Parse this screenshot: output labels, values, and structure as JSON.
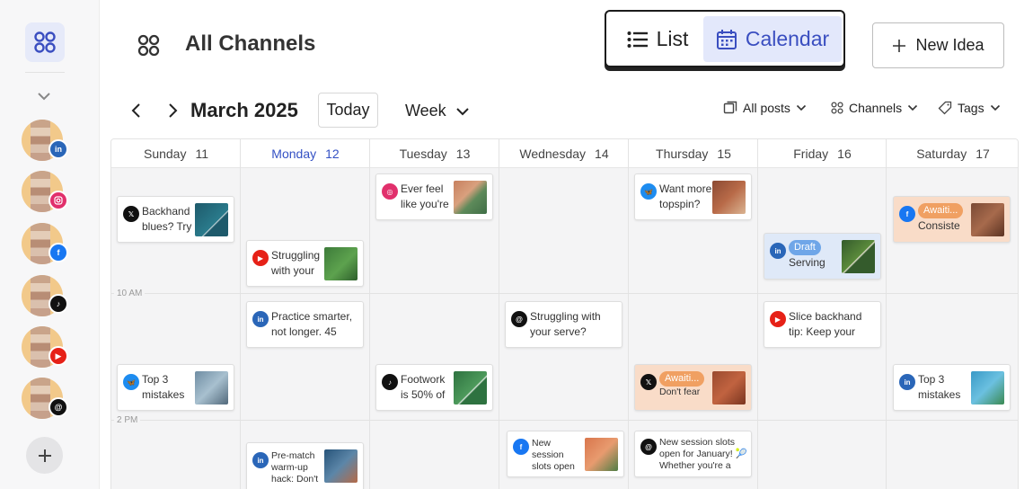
{
  "header": {
    "title": "All Channels"
  },
  "view_toggle": {
    "list": "List",
    "calendar": "Calendar"
  },
  "new_idea": "New Idea",
  "toolbar": {
    "month": "March 2025",
    "today": "Today",
    "range": "Week",
    "all_posts": "All posts",
    "channels": "Channels",
    "tags": "Tags"
  },
  "sidebar": {
    "channels": [
      "linkedin",
      "instagram",
      "facebook",
      "tiktok",
      "youtube",
      "threads"
    ]
  },
  "days": [
    {
      "name": "Sunday",
      "num": "11"
    },
    {
      "name": "Monday",
      "num": "12"
    },
    {
      "name": "Tuesday",
      "num": "13"
    },
    {
      "name": "Wednesday",
      "num": "14"
    },
    {
      "name": "Thursday",
      "num": "15"
    },
    {
      "name": "Friday",
      "num": "16"
    },
    {
      "name": "Saturday",
      "num": "17"
    }
  ],
  "times": {
    "t1": "10 AM",
    "t2": "2 PM"
  },
  "posts": {
    "p1": {
      "text": "Backhand blues? Try",
      "network": "x"
    },
    "p2": {
      "text": "Struggling with your",
      "network": "youtube"
    },
    "p3": {
      "text": "Ever feel like you're",
      "network": "instagram"
    },
    "p4": {
      "text": "Want more topspin?",
      "network": "bluesky"
    },
    "p5": {
      "status": "Awaiti...",
      "text": "Consiste",
      "network": "facebook"
    },
    "p6": {
      "status": "Draft",
      "text": "Serving",
      "network": "linkedin"
    },
    "p7": {
      "text": "Practice smarter, not longer. 45",
      "network": "linkedin"
    },
    "p8": {
      "text": "Struggling with your serve?",
      "network": "threads"
    },
    "p9": {
      "text": "Slice backhand tip: Keep your",
      "network": "youtube"
    },
    "p10": {
      "text": "Top 3 mistakes",
      "network": "bluesky"
    },
    "p11": {
      "text": "Footwork is 50% of",
      "network": "tiktok"
    },
    "p12": {
      "status": "Awaiti...",
      "text": "Don't fear",
      "network": "x"
    },
    "p13": {
      "text": "Top 3 mistakes",
      "network": "linkedin"
    },
    "p14": {
      "text": "Pre-match warm-up hack: Don't",
      "network": "linkedin"
    },
    "p15": {
      "text": "New session slots open",
      "network": "facebook"
    },
    "p16": {
      "text": "New session slots open for January! 🎾 Whether you're a",
      "network": "threads"
    }
  },
  "colors": {
    "accent": "#3451c4",
    "linkedin": "#2a66b8",
    "instagram": "#e1306c",
    "facebook": "#1877f2",
    "tiktok": "#111111",
    "youtube": "#e62117",
    "threads": "#111111",
    "x": "#111111",
    "bluesky": "#1d8cf0"
  }
}
